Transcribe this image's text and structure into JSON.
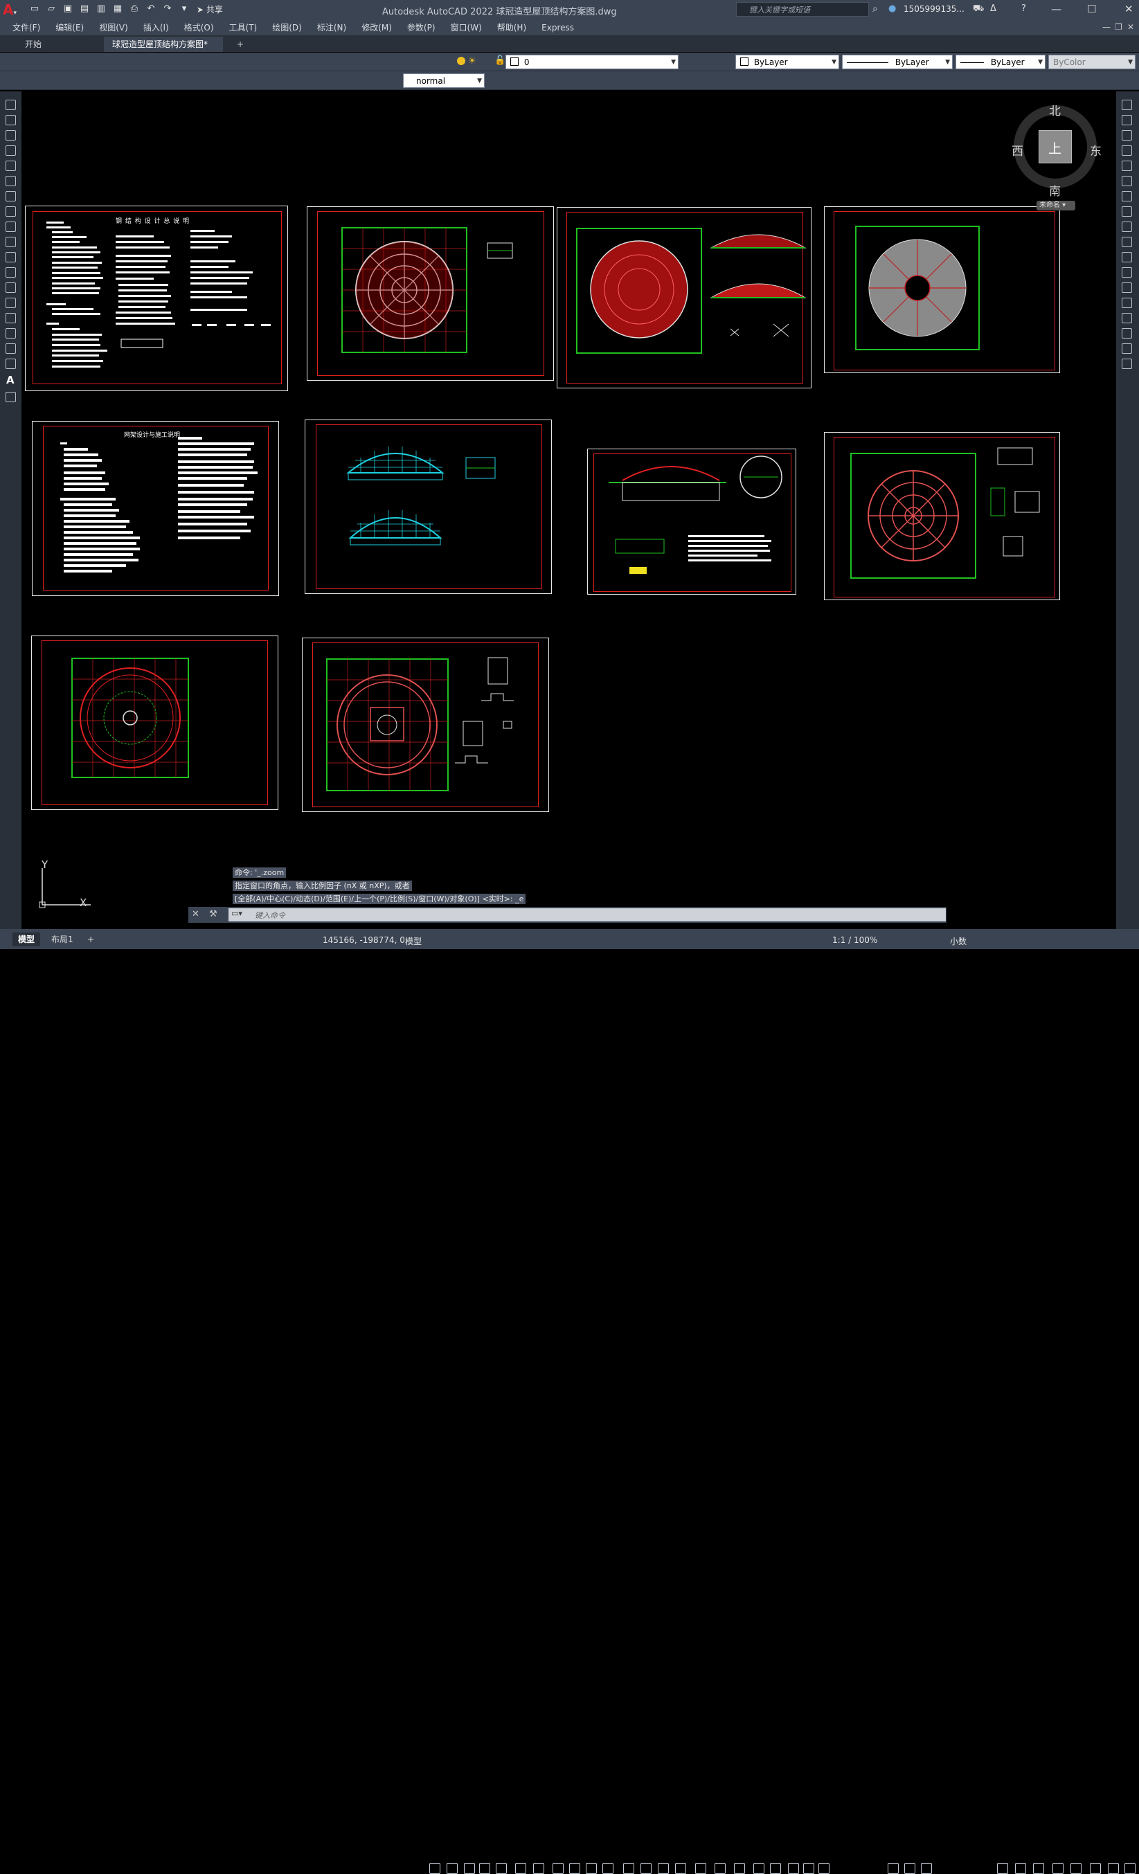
{
  "app": {
    "title": "Autodesk AutoCAD 2022    球冠造型屋顶结构方案图.dwg",
    "share_label": "共享",
    "search_placeholder": "键入关键字或短语",
    "user_label": "1505999135..."
  },
  "menu": [
    "文件(F)",
    "编辑(E)",
    "视图(V)",
    "插入(I)",
    "格式(O)",
    "工具(T)",
    "绘图(D)",
    "标注(N)",
    "修改(M)",
    "参数(P)",
    "窗口(W)",
    "帮助(H)",
    "Express"
  ],
  "tabs": {
    "start": "开始",
    "active": "球冠造型屋顶结构方案图*",
    "close_icon": "×",
    "add_icon": "+"
  },
  "toolbar": {
    "layer_value": "0",
    "color_value": "ByLayer",
    "linetype_value": "ByLayer",
    "lineweight_value": "ByLayer",
    "plotstyle_value": "ByColor",
    "textstyle_value": "normal"
  },
  "viewcube": {
    "north": "北",
    "south": "南",
    "east": "东",
    "west": "西",
    "top": "上",
    "wcs": "未命名"
  },
  "sheets": {
    "s1_title": "钢 结 构 设 计 总 说 明",
    "s5_title": "网架设计与施工说明"
  },
  "ucs": {
    "x": "X",
    "y": "Y"
  },
  "command": {
    "history": [
      "命令: '_.zoom",
      "指定窗口的角点，输入比例因子 (nX 或 nXP)，或者",
      "[全部(A)/中心(C)/动态(D)/范围(E)/上一个(P)/比例(S)/窗口(W)/对象(O)] <实时>: _e"
    ],
    "placeholder": "键入命令"
  },
  "status": {
    "model_tab": "模型",
    "layout_tab": "布局1",
    "add_tab": "+",
    "coordinates": "145166, -198774, 0",
    "model_label": "模型",
    "scale": "1:1 / 100%",
    "units": "小数"
  }
}
